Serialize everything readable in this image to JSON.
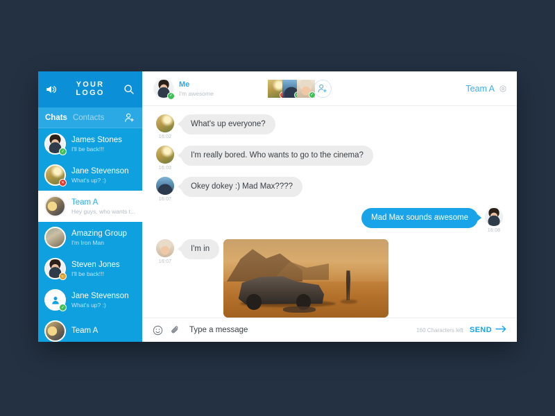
{
  "colors": {
    "page_background": "#233142",
    "sidebar_blue": "#0fa0e0",
    "brand_blue": "#0b8fd6",
    "tabs_blue": "#2aa9e4",
    "accent_blue": "#19a3e8",
    "bubble_grey": "#ececec",
    "online_green": "#3fbf56",
    "offline_red": "#e0392e",
    "away_orange": "#f0a320"
  },
  "sidebar": {
    "brand": {
      "icon": "speaker-icon",
      "logo_line1": "YOUR",
      "logo_line2": "LOGO",
      "search_icon": "search-icon"
    },
    "tabs": [
      {
        "label": "Chats",
        "active": true
      },
      {
        "label": "Contacts",
        "active": false
      }
    ],
    "add_contact_icon": "add-contact-icon",
    "chats": [
      {
        "name": "James Stones",
        "preview": "I'll be back!!!",
        "status": "online",
        "avatar": "man",
        "active": false
      },
      {
        "name": "Jane Stevenson",
        "preview": "What's up? :)",
        "status": "offline",
        "avatar": "field",
        "active": false
      },
      {
        "name": "Team A",
        "preview": "Hey guys, who wants t...",
        "status": "none",
        "avatar": "teamA",
        "active": true
      },
      {
        "name": "Amazing Group",
        "preview": "I'm Iron Man",
        "status": "none",
        "avatar": "group",
        "active": false
      },
      {
        "name": "Steven Jones",
        "preview": "I'll be back!!!",
        "status": "away",
        "avatar": "man",
        "active": false
      },
      {
        "name": "Jane Stevenson",
        "preview": "What's up? :)",
        "status": "online",
        "avatar": "blank",
        "active": false
      },
      {
        "name": "Team A",
        "preview": "",
        "status": "none",
        "avatar": "teamA",
        "active": false
      }
    ]
  },
  "header": {
    "me": {
      "name": "Me",
      "status_text": "I'm awesome",
      "status": "online",
      "avatar": "man"
    },
    "participants": [
      {
        "status": "offline",
        "avatar": "field"
      },
      {
        "status": "online",
        "avatar": "mountain"
      },
      {
        "status": "online",
        "avatar": "woman"
      }
    ],
    "add_person_icon": "add-person-icon",
    "room_title": "Team A",
    "settings_icon": "gear-icon"
  },
  "messages": [
    {
      "direction": "in",
      "text": "What's up everyone?",
      "time": "16:02",
      "avatar": "field",
      "type": "text"
    },
    {
      "direction": "in",
      "text": "I'm really bored. Who wants to go to the cinema?",
      "time": "16:03",
      "avatar": "field",
      "type": "text"
    },
    {
      "direction": "in",
      "text": "Okey dokey :) Mad Max????",
      "time": "16:07",
      "avatar": "mountain",
      "type": "text"
    },
    {
      "direction": "out",
      "text": "Mad Max sounds awesome",
      "time": "16:08",
      "avatar": "man",
      "type": "text"
    },
    {
      "direction": "in",
      "text": "I'm in",
      "time": "16:07",
      "avatar": "woman",
      "type": "text"
    },
    {
      "direction": "in",
      "text": "",
      "time": "",
      "avatar": "",
      "type": "image",
      "image_alt": "Mad Max desert scene with car"
    }
  ],
  "composer": {
    "emoji_icon": "emoji-icon",
    "attach_icon": "paperclip-icon",
    "input_value": "",
    "input_placeholder": "Type a message",
    "characters_left": "160 Characters left",
    "send_label": "SEND",
    "send_arrow_icon": "arrow-right-icon"
  }
}
